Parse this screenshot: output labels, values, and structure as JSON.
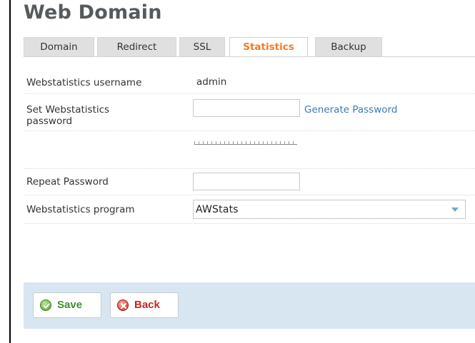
{
  "page": {
    "title": "Web Domain"
  },
  "tabs": [
    {
      "label": "Domain",
      "active": false
    },
    {
      "label": "Redirect",
      "active": false
    },
    {
      "label": "SSL",
      "active": false
    },
    {
      "label": "Statistics",
      "active": true
    },
    {
      "label": "Backup",
      "active": false
    }
  ],
  "form": {
    "username": {
      "label": "Webstatistics username",
      "value": "admin"
    },
    "password": {
      "label": "Set Webstatistics password",
      "value": "",
      "generate_label": "Generate Password"
    },
    "repeat_password": {
      "label": "Repeat Password",
      "value": ""
    },
    "program": {
      "label": "Webstatistics program",
      "selected": "AWStats"
    }
  },
  "footer": {
    "save_label": "Save",
    "back_label": "Back"
  },
  "colors": {
    "active_tab": "#f47b20",
    "link": "#3a79b4",
    "footer_bg": "#d8e6f1",
    "save": "#3f8f2a",
    "back": "#c7251e"
  },
  "icons": {
    "save": "check-circle-icon",
    "back": "x-circle-icon",
    "dropdown": "chevron-down-icon"
  }
}
